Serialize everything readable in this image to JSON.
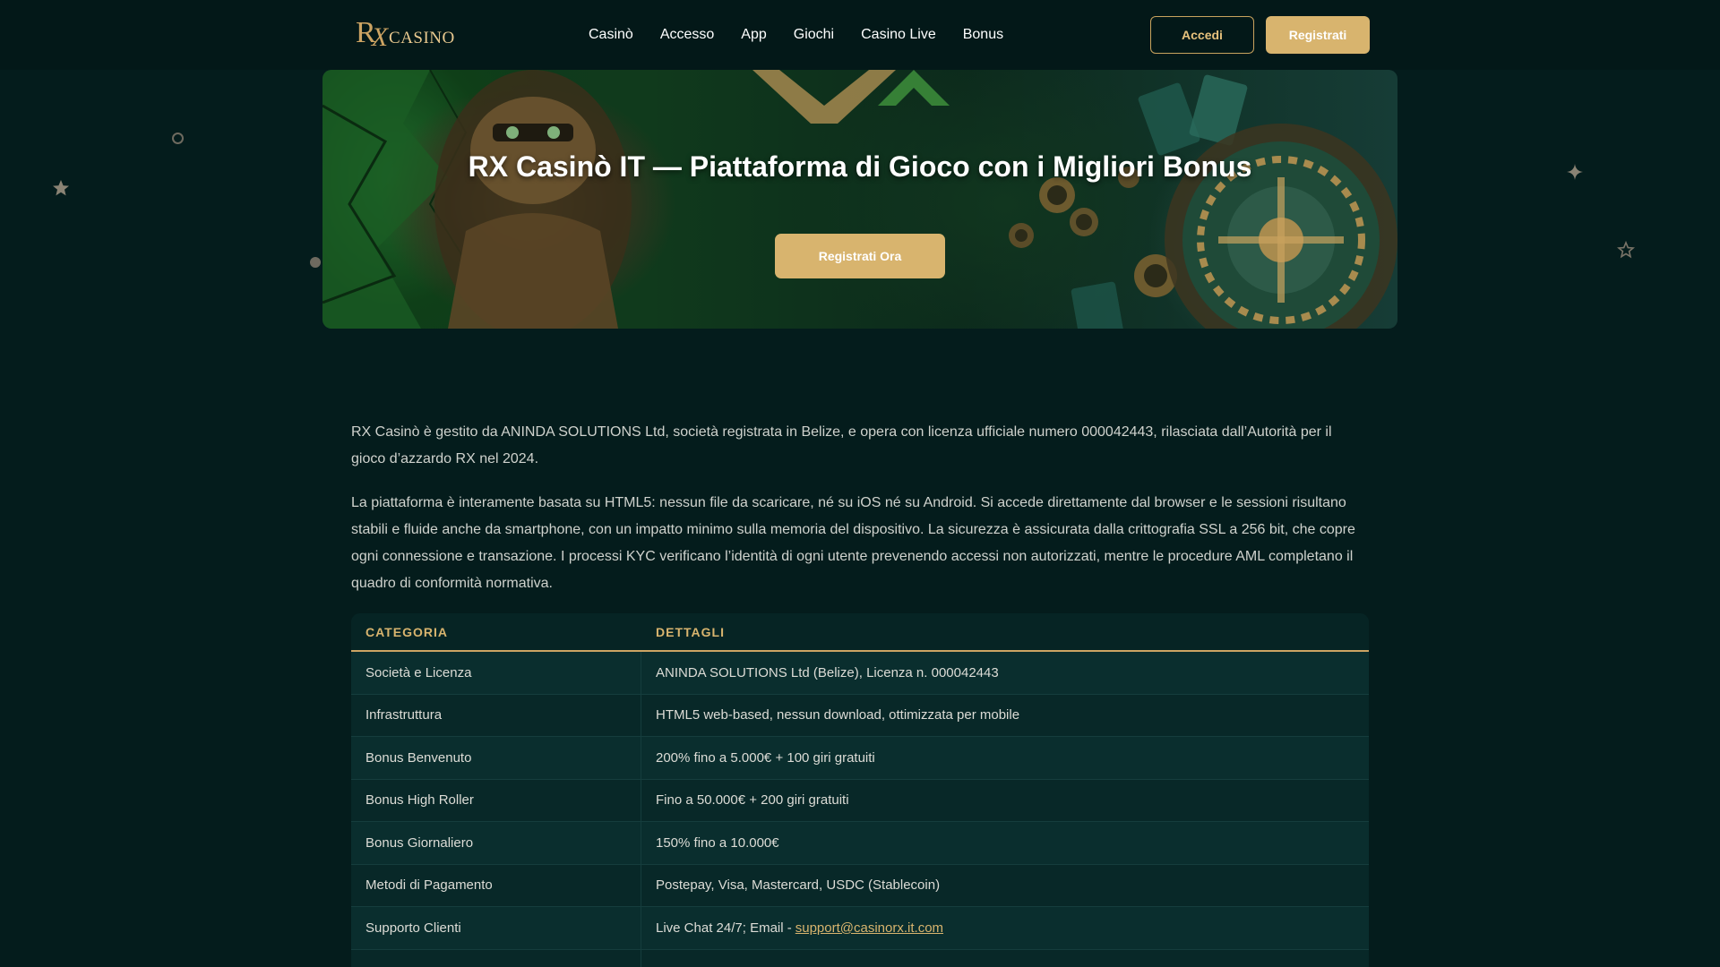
{
  "header": {
    "logo_rx": "R",
    "logo_x": "X",
    "logo_text": "CASINO",
    "nav": [
      "Casinò",
      "Accesso",
      "App",
      "Giochi",
      "Casino Live",
      "Bonus"
    ],
    "login_label": "Accedi",
    "register_label": "Registrati"
  },
  "hero": {
    "title": "RX Casinò IT — Piattaforma di Gioco con i Migliori Bonus",
    "cta_label": "Registrati Ora"
  },
  "content": {
    "paragraphs": [
      "RX Casinò è gestito da ANINDA SOLUTIONS Ltd, società registrata in Belize, e opera con licenza ufficiale numero 000042443, rilasciata dall’Autorità per il gioco d’azzardo RX nel 2024.",
      "La piattaforma è interamente basata su HTML5: nessun file da scaricare, né su iOS né su Android. Si accede direttamente dal browser e le sessioni risultano stabili e fluide anche da smartphone, con un impatto minimo sulla memoria del dispositivo. La sicurezza è assicurata dalla crittografia SSL a 256 bit, che copre ogni connessione e transazione. I processi KYC verificano l’identità di ogni utente prevenendo accessi non autorizzati, mentre le procedure AML completano il quadro di conformità normativa."
    ]
  },
  "table": {
    "headers": [
      "CATEGORIA",
      "DETTAGLI"
    ],
    "rows": [
      {
        "category": "Società e Licenza",
        "details": "ANINDA SOLUTIONS Ltd (Belize), Licenza n. 000042443"
      },
      {
        "category": "Infrastruttura",
        "details": "HTML5 web-based, nessun download, ottimizzata per mobile"
      },
      {
        "category": "Bonus Benvenuto",
        "details": "200% fino a 5.000€ + 100 giri gratuiti"
      },
      {
        "category": "Bonus High Roller",
        "details": "Fino a 50.000€ + 200 giri gratuiti"
      },
      {
        "category": "Bonus Giornaliero",
        "details": "150% fino a 10.000€"
      },
      {
        "category": "Metodi di Pagamento",
        "details": "Postepay, Visa, Mastercard, USDC (Stablecoin)"
      },
      {
        "category": "Supporto Clienti",
        "details": "Live Chat 24/7; Email -",
        "link": "support@casinorx.it.com"
      }
    ]
  },
  "colors": {
    "background": "#041c1c",
    "accent_gold": "#d8b46e",
    "table_bg": "#082929"
  },
  "icons": [
    "star-icon",
    "sparkle-icon",
    "star-outline-icon",
    "circle-outline-icon",
    "dot-icon"
  ]
}
